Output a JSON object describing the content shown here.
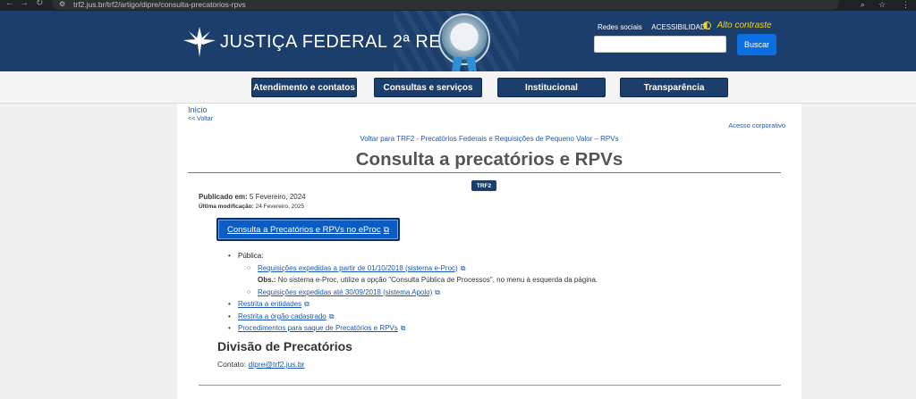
{
  "browser": {
    "url": "trf2.jus.br/trf2/artigo/dipre/consulta-precatorios-rpvs"
  },
  "header": {
    "brand": "JUSTIÇA FEDERAL 2ª REGIÃO",
    "links": [
      "Redes sociais",
      "ACESSIBILIDADE"
    ],
    "contrast_label": "Alto contraste",
    "search_value": "",
    "search_button": "Buscar"
  },
  "nav": {
    "items": [
      "Atendimento e contatos",
      "Consultas e serviços",
      "Institucional",
      "Transparência"
    ]
  },
  "content": {
    "breadcrumb": "Início",
    "back": "<< Voltar",
    "corporate": "Acesso corporativo",
    "back_to": "Voltar para TRF2 - Precatórios Federais e Requisições de Pequeno Valor – RPVs",
    "title": "Consulta a precatórios e RPVs",
    "badge": "TRF2",
    "published_label": "Publicado em:",
    "published_value": "5 Fevereiro, 2024",
    "modified_label": "Última modificação:",
    "modified_value": "24 Fevereiro, 2025",
    "eproc_button": "Consulta a Precatórios e RPVs no eProc",
    "list": {
      "publica": "Pública:",
      "req1": "Requisições expedidas a partir de 01/10/2018 (sistema e-Proc)",
      "obs_label": "Obs.:",
      "obs_text": "No sistema e-Proc, utilize a opção \"Consulta Pública de Processos\", no menu à esquerda da página.",
      "req2": "Requisições expedidas até 30/09/2018 (sistema Apolo)",
      "item2": "Restrita a entidades",
      "item3": "Restrita a órgão cadastrado",
      "item4": "Procedimentos para saque de Precatórios e RPVs"
    },
    "division_title": "Divisão de Precatórios",
    "contact_label": "Contato:",
    "contact_email": "dipre@trf2.jus.br"
  },
  "colors": {
    "header_bg": "#1b3e6c",
    "accent_blue": "#0b6fe0",
    "contrast_yellow": "#f2d21b",
    "link": "#1a57b2"
  }
}
